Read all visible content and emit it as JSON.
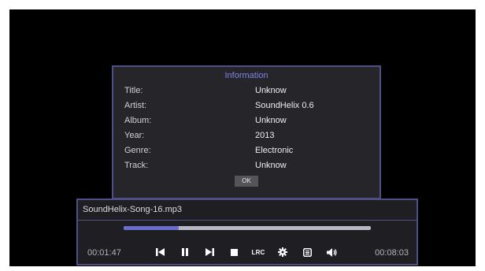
{
  "info_dialog": {
    "title": "Information",
    "rows": [
      {
        "label": "Title:",
        "value": "Unknow"
      },
      {
        "label": "Artist:",
        "value": "SoundHelix 0.6"
      },
      {
        "label": "Album:",
        "value": "Unknow"
      },
      {
        "label": "Year:",
        "value": "2013"
      },
      {
        "label": "Genre:",
        "value": "Electronic"
      },
      {
        "label": "Track:",
        "value": "Unknow"
      }
    ],
    "ok_label": "OK"
  },
  "player": {
    "song_name": "SoundHelix-Song-16.mp3",
    "elapsed": "00:01:47",
    "total": "00:08:03",
    "progress_fraction": 0.222,
    "controls": [
      {
        "name": "previous-icon"
      },
      {
        "name": "pause-icon"
      },
      {
        "name": "next-icon"
      },
      {
        "name": "stop-icon"
      },
      {
        "name": "lrc-button",
        "label": "LRC"
      },
      {
        "name": "settings-icon"
      },
      {
        "name": "playlist-icon"
      },
      {
        "name": "volume-icon"
      }
    ]
  },
  "colors": {
    "accent": "#6a6dcc",
    "dialog_border": "#4d4f86",
    "dialog_title": "#7f82e6"
  }
}
